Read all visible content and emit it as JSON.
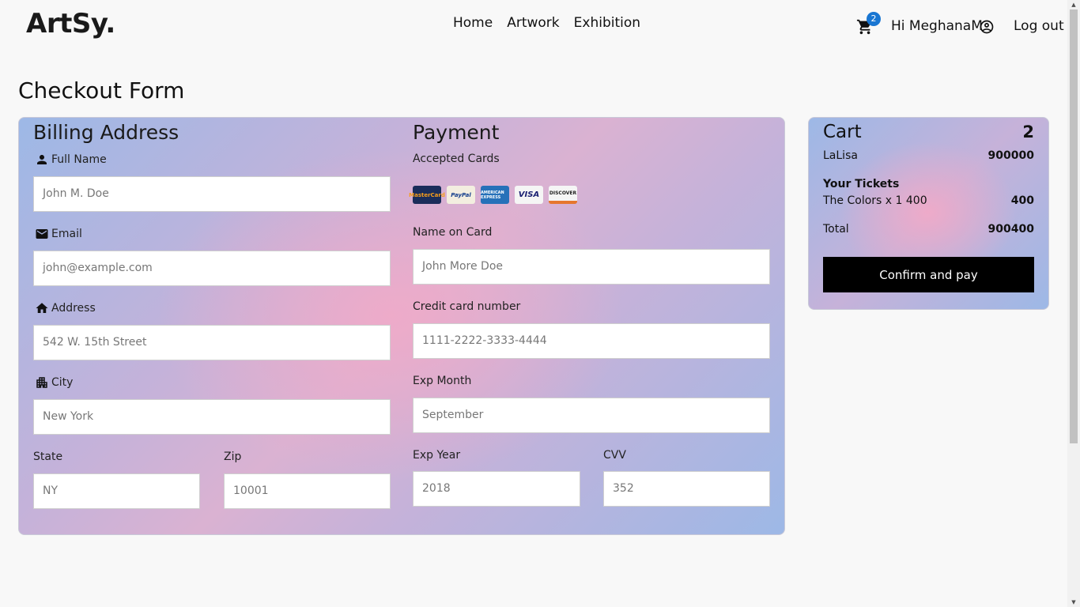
{
  "header": {
    "logo": "ArtSy.",
    "nav": [
      "Home",
      "Artwork",
      "Exhibition"
    ],
    "cart_badge": "2",
    "greeting": "Hi MeghanaM",
    "logout": "Log out"
  },
  "page_title": "Checkout Form",
  "billing": {
    "title": "Billing Address",
    "full_name_label": "Full Name",
    "full_name_placeholder": "John M. Doe",
    "email_label": "Email",
    "email_placeholder": "john@example.com",
    "address_label": "Address",
    "address_placeholder": "542 W. 15th Street",
    "city_label": "City",
    "city_placeholder": "New York",
    "state_label": "State",
    "state_placeholder": "NY",
    "zip_label": "Zip",
    "zip_placeholder": "10001"
  },
  "payment": {
    "title": "Payment",
    "accepted_label": "Accepted Cards",
    "cards": [
      "MasterCard",
      "PayPal",
      "AMERICAN EXPRESS",
      "VISA",
      "DISCOVER"
    ],
    "name_label": "Name on Card",
    "name_placeholder": "John More Doe",
    "number_label": "Credit card number",
    "number_placeholder": "1111-2222-3333-4444",
    "exp_month_label": "Exp Month",
    "exp_month_placeholder": "September",
    "exp_year_label": "Exp Year",
    "exp_year_placeholder": "2018",
    "cvv_label": "CVV",
    "cvv_placeholder": "352"
  },
  "cart": {
    "title": "Cart",
    "count": "2",
    "item_name": "LaLisa",
    "item_value": "900000",
    "tickets_head": "Your Tickets",
    "ticket_name": "The Colors x 1 400",
    "ticket_value": "400",
    "total_label": "Total",
    "total_value": "900400",
    "confirm": "Confirm and pay"
  },
  "icons": {
    "cart": "shopping-cart-icon",
    "user": "account-circle-icon",
    "person": "person-icon",
    "email": "mail-icon",
    "home": "home-icon",
    "city": "apartment-icon"
  }
}
